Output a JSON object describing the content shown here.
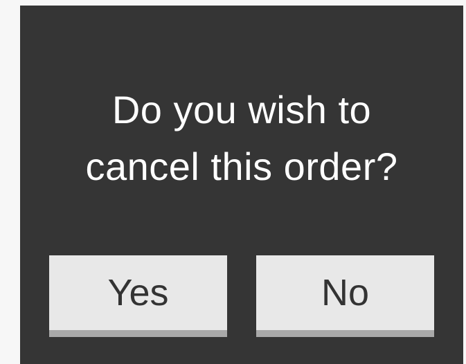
{
  "dialog": {
    "message_line1": "Do you wish to",
    "message_line2": "cancel this order?",
    "yes_label": "Yes",
    "no_label": "No"
  },
  "colors": {
    "page_background": "#f7f7f7",
    "dialog_background": "#353535",
    "message_text": "#ffffff",
    "button_face": "#e8e8e8",
    "button_shadow": "#a9a9a9",
    "button_text": "#333333"
  }
}
